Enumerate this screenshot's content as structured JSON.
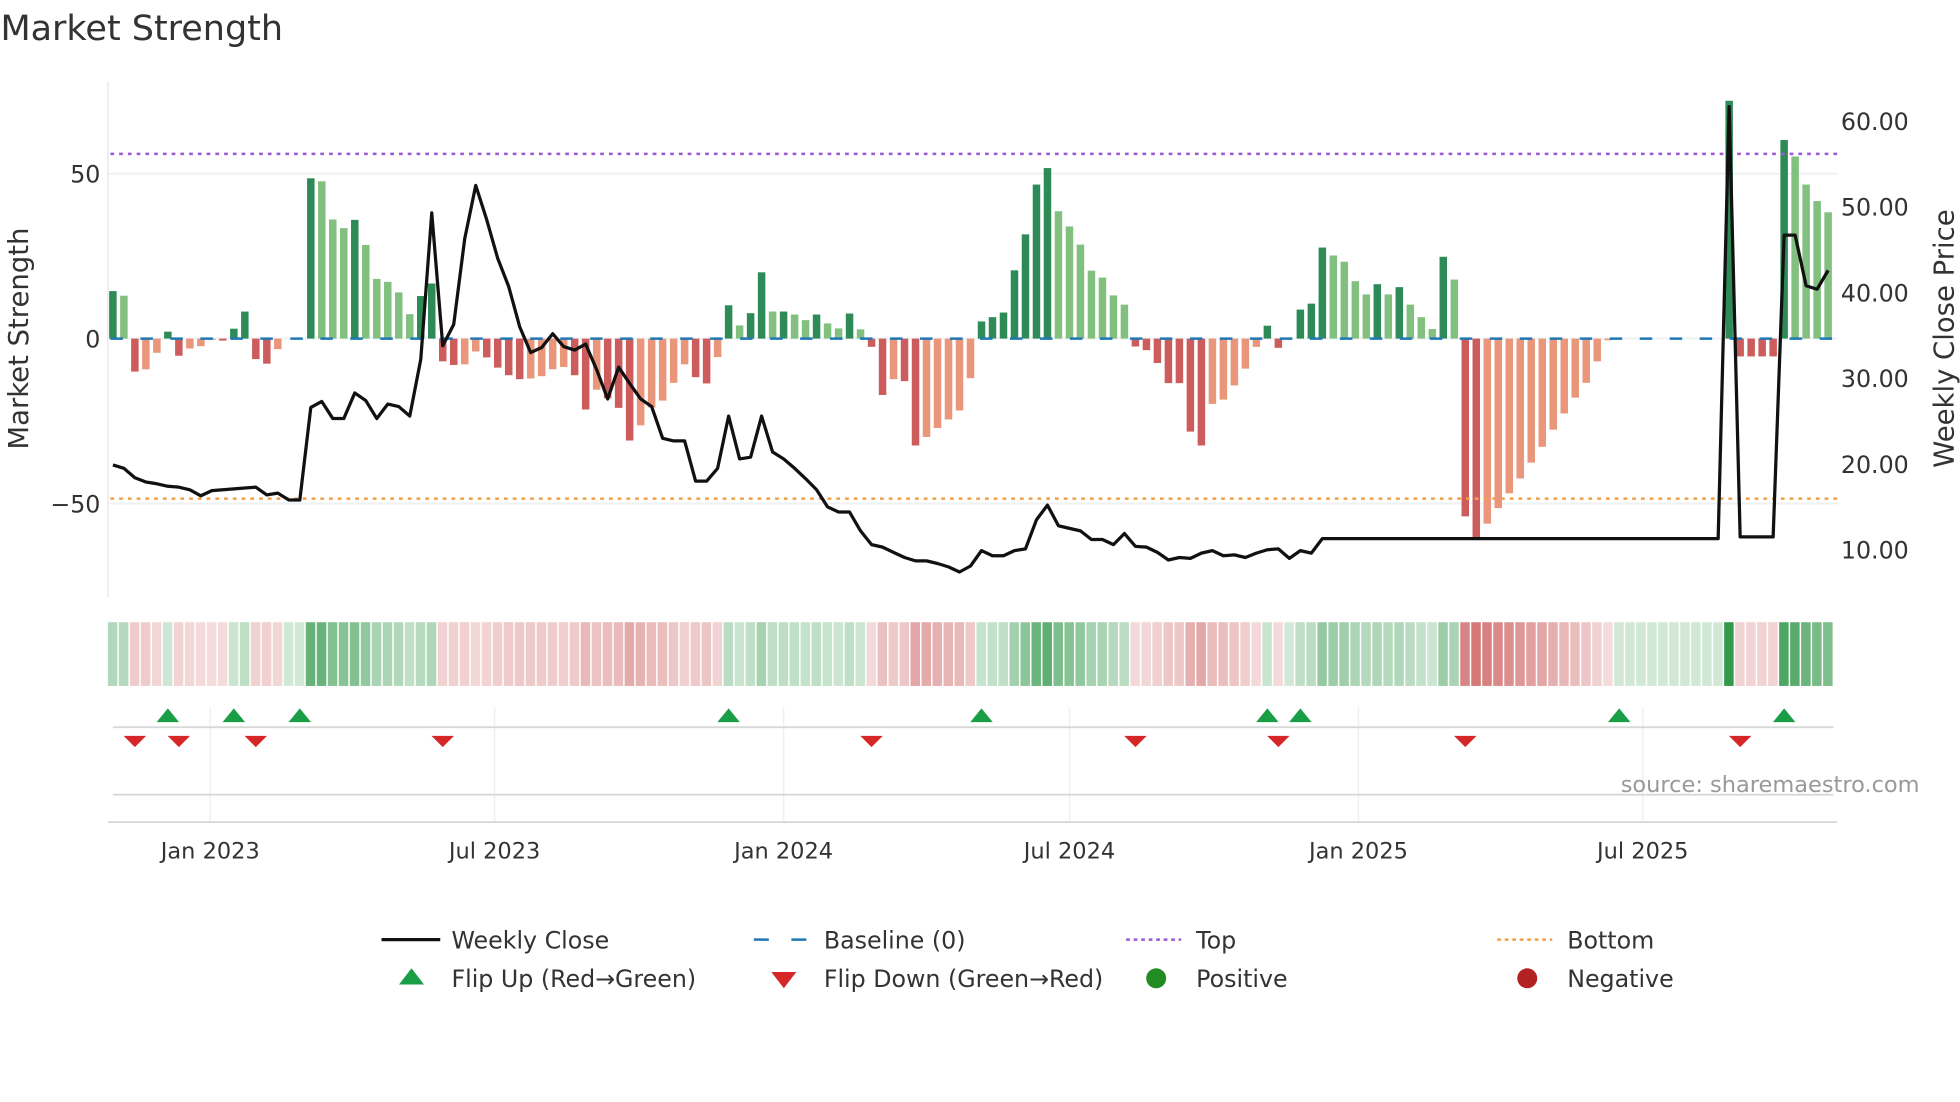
{
  "chart_data": {
    "type": "bar",
    "title": "Market Strength",
    "frequency": "weekly",
    "start_date": "2022-10-31",
    "y_left": {
      "label": "Market Strength",
      "lim": [
        -78,
        78
      ],
      "ticks": [
        {
          "v": 50,
          "label": "50"
        },
        {
          "v": 0,
          "label": "0"
        },
        {
          "v": -50,
          "label": "−50"
        }
      ]
    },
    "y_right": {
      "label": "Weekly Close Price",
      "lim": [
        4.5,
        64.7
      ],
      "ticks": [
        {
          "v": 60,
          "label": "60.00"
        },
        {
          "v": 50,
          "label": "50.00"
        },
        {
          "v": 40,
          "label": "40.00"
        },
        {
          "v": 30,
          "label": "30.00"
        },
        {
          "v": 20,
          "label": "20.00"
        },
        {
          "v": 10,
          "label": "10.00"
        }
      ]
    },
    "x_ticks": [
      {
        "date": "2023-01-01",
        "label": "Jan 2023"
      },
      {
        "date": "2023-07-01",
        "label": "Jul 2023"
      },
      {
        "date": "2024-01-01",
        "label": "Jan 2024"
      },
      {
        "date": "2024-07-01",
        "label": "Jul 2024"
      },
      {
        "date": "2025-01-01",
        "label": "Jan 2025"
      },
      {
        "date": "2025-07-01",
        "label": "Jul 2025"
      }
    ],
    "reference_lines": {
      "baseline": 0,
      "top": 56,
      "bottom": -48.5
    },
    "strength": [
      14.4,
      13,
      -10,
      -9.3,
      -4.3,
      2.1,
      -5.2,
      -3,
      -2.3,
      -0.3,
      -0.6,
      3,
      8.2,
      -6.2,
      -7.6,
      -3.2,
      0,
      0,
      48.6,
      47.7,
      36.1,
      33.5,
      36,
      28.4,
      18.1,
      17.2,
      14,
      7.4,
      12.9,
      16.7,
      -6.9,
      -8,
      -7.8,
      -3.9,
      -5.7,
      -8.8,
      -11.1,
      -12.3,
      -12.1,
      -11.4,
      -9.3,
      -8.6,
      -11.1,
      -21.5,
      -15.5,
      -18.1,
      -21,
      -30.9,
      -26.3,
      -20.9,
      -18.8,
      -13.4,
      -7.8,
      -11.7,
      -13.6,
      -5.6,
      10.1,
      4,
      7.7,
      20.1,
      8.2,
      8.2,
      7.3,
      5.6,
      7.3,
      4.6,
      3.1,
      7.6,
      2.8,
      -2.5,
      -17.1,
      -12.3,
      -12.9,
      -32.4,
      -29.8,
      -27.1,
      -24.5,
      -21.8,
      -12,
      5.2,
      6.5,
      7.9,
      20.7,
      31.6,
      46.7,
      51.7,
      38.6,
      34,
      28.5,
      20.6,
      18.5,
      13.1,
      10.3,
      -2.4,
      -3.5,
      -7.4,
      -13.5,
      -13.5,
      -28.2,
      -32.4,
      -19.8,
      -18.5,
      -14.2,
      -9.1,
      -2.5,
      3.9,
      -2.8,
      0,
      8.8,
      10.6,
      27.6,
      25.2,
      23.3,
      17.4,
      13.4,
      16.5,
      13.4,
      15.6,
      10.3,
      6.5,
      2.9,
      24.8,
      17.9,
      -53.9,
      -60.6,
      -56.1,
      -51.4,
      -46.9,
      -42.4,
      -37.6,
      -32.8,
      -27.6,
      -22.7,
      -17.9,
      -13.4,
      -6.9,
      -0.5,
      0,
      0,
      0,
      0,
      0,
      0,
      0,
      0,
      0,
      0,
      72.1,
      -5.4,
      -5.4,
      -5.4,
      -5.4,
      60.2,
      55.2,
      46.7,
      41.7,
      38.3
    ],
    "weekly_close": [
      19.9,
      19.5,
      18.4,
      17.9,
      17.7,
      17.4,
      17.3,
      17,
      16.3,
      16.9,
      17,
      17.1,
      17.2,
      17.3,
      16.4,
      16.6,
      15.8,
      15.8,
      26.6,
      27.3,
      25.3,
      25.3,
      28.3,
      27.4,
      25.3,
      27,
      26.7,
      25.6,
      32.2,
      49.3,
      33.8,
      36.3,
      46.3,
      52.5,
      48.5,
      44,
      40.7,
      36,
      33,
      33.6,
      35.2,
      33.7,
      33.3,
      34,
      31,
      27.6,
      31.3,
      29.4,
      27.6,
      26.7,
      23,
      22.7,
      22.7,
      18,
      18,
      19.5,
      25.6,
      20.6,
      20.8,
      25.6,
      21.4,
      20.6,
      19.5,
      18.3,
      17,
      15,
      14.4,
      14.4,
      12.2,
      10.6,
      10.3,
      9.7,
      9.1,
      8.7,
      8.7,
      8.4,
      8,
      7.4,
      8.1,
      9.9,
      9.3,
      9.3,
      9.9,
      10.1,
      13.5,
      15.2,
      12.8,
      12.5,
      12.2,
      11.2,
      11.2,
      10.6,
      11.9,
      10.4,
      10.3,
      9.7,
      8.8,
      9.1,
      9,
      9.6,
      9.9,
      9.3,
      9.4,
      9.1,
      9.6,
      10,
      10.1,
      9,
      9.9,
      9.6,
      11.3,
      11.3,
      11.3,
      11.3,
      11.3,
      11.3,
      11.3,
      11.3,
      11.3,
      11.3,
      11.3,
      11.3,
      11.3,
      11.3,
      11.3,
      11.3,
      11.3,
      11.3,
      11.3,
      11.3,
      11.3,
      11.3,
      11.3,
      11.3,
      11.3,
      11.3,
      11.3,
      11.3,
      11.3,
      11.3,
      11.3,
      11.3,
      11.3,
      11.3,
      11.3,
      11.3,
      11.3,
      61.7,
      11.5,
      11.5,
      11.5,
      11.5,
      46.7,
      46.7,
      40.8,
      40.4,
      42.6
    ],
    "flip_up_weeks": [
      5,
      11,
      17,
      56,
      79,
      105,
      108,
      137,
      152
    ],
    "flip_down_weeks": [
      2,
      6,
      13,
      30,
      69,
      93,
      106,
      123,
      148
    ],
    "legend": [
      {
        "label": "Weekly Close",
        "kind": "line"
      },
      {
        "label": "Baseline (0)",
        "kind": "dash"
      },
      {
        "label": "Top",
        "kind": "dot-top"
      },
      {
        "label": "Bottom",
        "kind": "dot-bottom"
      },
      {
        "label": "Flip Up (Red→Green)",
        "kind": "tri-up"
      },
      {
        "label": "Flip Down (Green→Red)",
        "kind": "tri-down"
      },
      {
        "label": "Positive",
        "kind": "circle-pos"
      },
      {
        "label": "Negative",
        "kind": "circle-neg"
      }
    ],
    "legend_placement": "bottom",
    "source": "source: sharemaestro.com",
    "colors": {
      "up_strong": "#2e8b57",
      "up_weak": "#82c07f",
      "down_strong": "#cd5c5c",
      "down_weak": "#e9967a",
      "baseline": "#1f77b4",
      "top": "#9b59d6",
      "bottom": "#f0a04b",
      "flip_up": "#1a9e45",
      "flip_down": "#d62728",
      "positive": "#228b22",
      "negative": "#b22222",
      "close": "#111111"
    }
  }
}
